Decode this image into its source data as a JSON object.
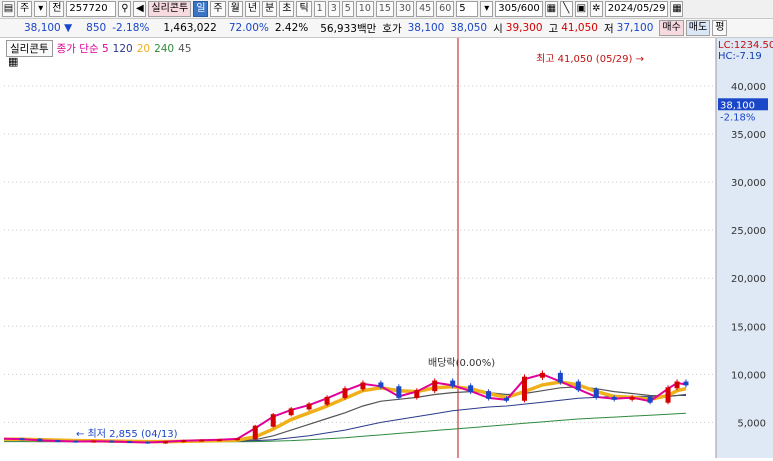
{
  "toolbar": {
    "icon_main": "▤",
    "market_label": "주",
    "dropdown1": "▾",
    "period_label": "전",
    "code_value": "257720",
    "search_icon": "🔍",
    "speaker_icon": "◀",
    "stock_name": "실리콘투",
    "tag_label": "일",
    "period_buttons": [
      "주",
      "월",
      "년",
      "분",
      "초",
      "틱"
    ],
    "minute_buttons": [
      "1",
      "3",
      "5",
      "10",
      "15",
      "30",
      "45",
      "60"
    ],
    "count_value": "5",
    "view_range": "305/600",
    "date_value": "2024/05/29"
  },
  "status": {
    "price": "38,100",
    "change": "850",
    "change_pct": "-2.18%",
    "volume": "1,463,022",
    "volume_pct": "72.00%",
    "turnover_pct": "2.42%",
    "amount": "56,933백만",
    "ask_label": "호가",
    "ask1": "38,100",
    "ask2": "38,050",
    "open_label": "시",
    "open": "39,300",
    "high_label": "고",
    "high": "41,050",
    "low_label": "저",
    "low": "37,100",
    "buy_label": "매수",
    "sell_label": "매도",
    "eval_label": "평"
  },
  "legend": {
    "name": "실리콘투",
    "ma_label": "종가 단순 5",
    "ma120": "120",
    "ma20": "20",
    "ma240": "240",
    "ma45": "45"
  },
  "annotations": {
    "high_label": "최고 41,050 (05/29)",
    "low_label": "최저 2,855 (04/13)",
    "dividend_label": "배당락(0.00%)",
    "lc_label": "LC:1234.50",
    "hc_label": "HC:-7.19",
    "last_price": "38,100",
    "last_pct": "-2.18%"
  },
  "colors": {
    "rise": "#d40000",
    "fall": "#1a46c8",
    "ma5": "#e0009a",
    "ma20": "#f0b01a",
    "ma45": "#555555",
    "ma120": "#2a3a8a",
    "ma240": "#2e8b3e"
  },
  "chart_data": {
    "type": "line",
    "y_axis": {
      "ticks": [
        40000,
        35000,
        30000,
        25000,
        20000,
        15000,
        10000,
        5000
      ],
      "tick_labels": [
        "40,000",
        "35,000",
        "30,000",
        "25,000",
        "20,000",
        "15,000",
        "10,000",
        "5,000"
      ],
      "ylim": [
        1500,
        42500
      ]
    },
    "x": [
      0,
      8,
      16,
      24,
      32,
      40,
      48,
      56,
      64,
      72,
      80,
      88,
      96,
      104,
      112,
      120,
      128,
      136,
      144,
      152,
      160,
      168,
      176,
      184,
      192,
      200,
      208,
      216,
      224,
      232,
      240,
      248,
      256,
      264,
      272,
      280,
      288,
      296,
      300,
      304
    ],
    "series": [
      {
        "name": "종가",
        "values": [
          3300,
          3250,
          3100,
          3050,
          3000,
          3050,
          3000,
          2950,
          2855,
          3000,
          3100,
          3150,
          3200,
          3300,
          4600,
          5800,
          6400,
          6900,
          7600,
          8500,
          9100,
          8700,
          7600,
          8300,
          9300,
          8800,
          8200,
          7500,
          7300,
          9700,
          10100,
          9200,
          8400,
          7600,
          7400,
          7600,
          7100,
          8600,
          9200,
          8900
        ]
      },
      {
        "name": "5",
        "values": [
          3300,
          3260,
          3120,
          3060,
          3010,
          3040,
          3010,
          2960,
          2900,
          2980,
          3080,
          3140,
          3190,
          3280,
          4400,
          5600,
          6300,
          6800,
          7500,
          8300,
          9000,
          8750,
          7700,
          8200,
          9150,
          8850,
          8250,
          7550,
          7350,
          9500,
          10000,
          9250,
          8450,
          7650,
          7450,
          7580,
          7200,
          8500,
          9100,
          8950
        ]
      },
      {
        "name": "20",
        "values": [
          3250,
          3240,
          3200,
          3150,
          3100,
          3080,
          3050,
          3020,
          3000,
          3000,
          3020,
          3060,
          3100,
          3150,
          3500,
          4300,
          5300,
          6000,
          6700,
          7500,
          8300,
          8600,
          8300,
          8200,
          8600,
          8700,
          8500,
          8000,
          7600,
          8200,
          8900,
          9200,
          8900,
          8200,
          7700,
          7600,
          7400,
          7800,
          8300,
          8500
        ]
      },
      {
        "name": "45",
        "values": [
          3200,
          3200,
          3190,
          3170,
          3150,
          3130,
          3110,
          3090,
          3070,
          3050,
          3050,
          3060,
          3080,
          3100,
          3200,
          3600,
          4200,
          4800,
          5400,
          6000,
          6700,
          7200,
          7400,
          7600,
          7900,
          8100,
          8200,
          8100,
          7900,
          8000,
          8300,
          8600,
          8700,
          8500,
          8200,
          8000,
          7800,
          7700,
          7800,
          7900
        ]
      },
      {
        "name": "120",
        "values": [
          3100,
          3100,
          3100,
          3090,
          3080,
          3070,
          3060,
          3050,
          3040,
          3030,
          3030,
          3030,
          3040,
          3050,
          3100,
          3200,
          3400,
          3600,
          3900,
          4200,
          4600,
          5000,
          5300,
          5600,
          5900,
          6200,
          6400,
          6600,
          6700,
          6900,
          7100,
          7300,
          7500,
          7600,
          7700,
          7700,
          7700,
          7700,
          7800,
          7800
        ]
      },
      {
        "name": "240",
        "values": [
          3000,
          3000,
          2990,
          2990,
          2980,
          2980,
          2980,
          2970,
          2970,
          2970,
          2970,
          2970,
          2980,
          2990,
          3000,
          3050,
          3100,
          3200,
          3300,
          3400,
          3550,
          3700,
          3850,
          4000,
          4150,
          4300,
          4450,
          4600,
          4750,
          4900,
          5050,
          5200,
          5350,
          5450,
          5550,
          5650,
          5750,
          5850,
          5900,
          5950
        ]
      }
    ]
  }
}
